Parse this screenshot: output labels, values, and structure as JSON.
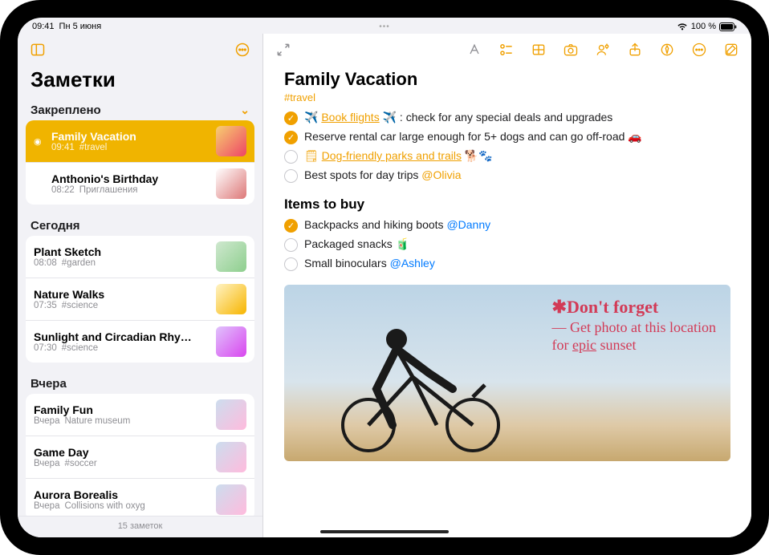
{
  "status": {
    "time": "09:41",
    "date": "Пн 5 июня",
    "battery_pct": "100 %"
  },
  "sidebar": {
    "title": "Заметки",
    "footer": "15 заметок",
    "pinned_header": "Закреплено",
    "today_header": "Сегодня",
    "yesterday_header": "Вчера",
    "pinned": [
      {
        "title": "Family Vacation",
        "time": "09:41",
        "tag": "#travel"
      },
      {
        "title": "Anthonio's Birthday",
        "time": "08:22",
        "tag": "Приглашения"
      }
    ],
    "today": [
      {
        "title": "Plant Sketch",
        "time": "08:08",
        "tag": "#garden"
      },
      {
        "title": "Nature Walks",
        "time": "07:35",
        "tag": "#science"
      },
      {
        "title": "Sunlight and Circadian Rhy…",
        "time": "07:30",
        "tag": "#science"
      }
    ],
    "yesterday": [
      {
        "title": "Family Fun",
        "time": "Вчера",
        "tag": "Nature museum"
      },
      {
        "title": "Game Day",
        "time": "Вчера",
        "tag": "#soccer"
      },
      {
        "title": "Aurora Borealis",
        "time": "Вчера",
        "tag": "Collisions with oxyg"
      }
    ]
  },
  "note": {
    "title": "Family Vacation",
    "tag": "#travel",
    "checks": [
      {
        "done": true,
        "pre_emoji": "✈️",
        "link": "Book flights",
        "post_emoji": "✈️",
        "text": ": check for any special deals and upgrades"
      },
      {
        "done": true,
        "text": "Reserve rental car large enough for 5+ dogs and can go off-road 🚗"
      },
      {
        "done": false,
        "note_icon": true,
        "link": "Dog-friendly parks and trails",
        "post_emoji": " 🐕🐾"
      },
      {
        "done": false,
        "text": "Best spots for day trips ",
        "mention": "@Olivia",
        "mention_orange": true
      }
    ],
    "section2": "Items to buy",
    "checks2": [
      {
        "done": true,
        "text": "Backpacks and hiking boots ",
        "mention": "@Danny"
      },
      {
        "done": false,
        "text": "Packaged snacks 🧃"
      },
      {
        "done": false,
        "text": "Small binoculars ",
        "mention": "@Ashley"
      }
    ],
    "handwriting": {
      "title": "✱Don't forget",
      "line1": "— Get photo at this location",
      "line2_a": "for ",
      "line2_b": "epic",
      "line2_c": " sunset"
    }
  }
}
